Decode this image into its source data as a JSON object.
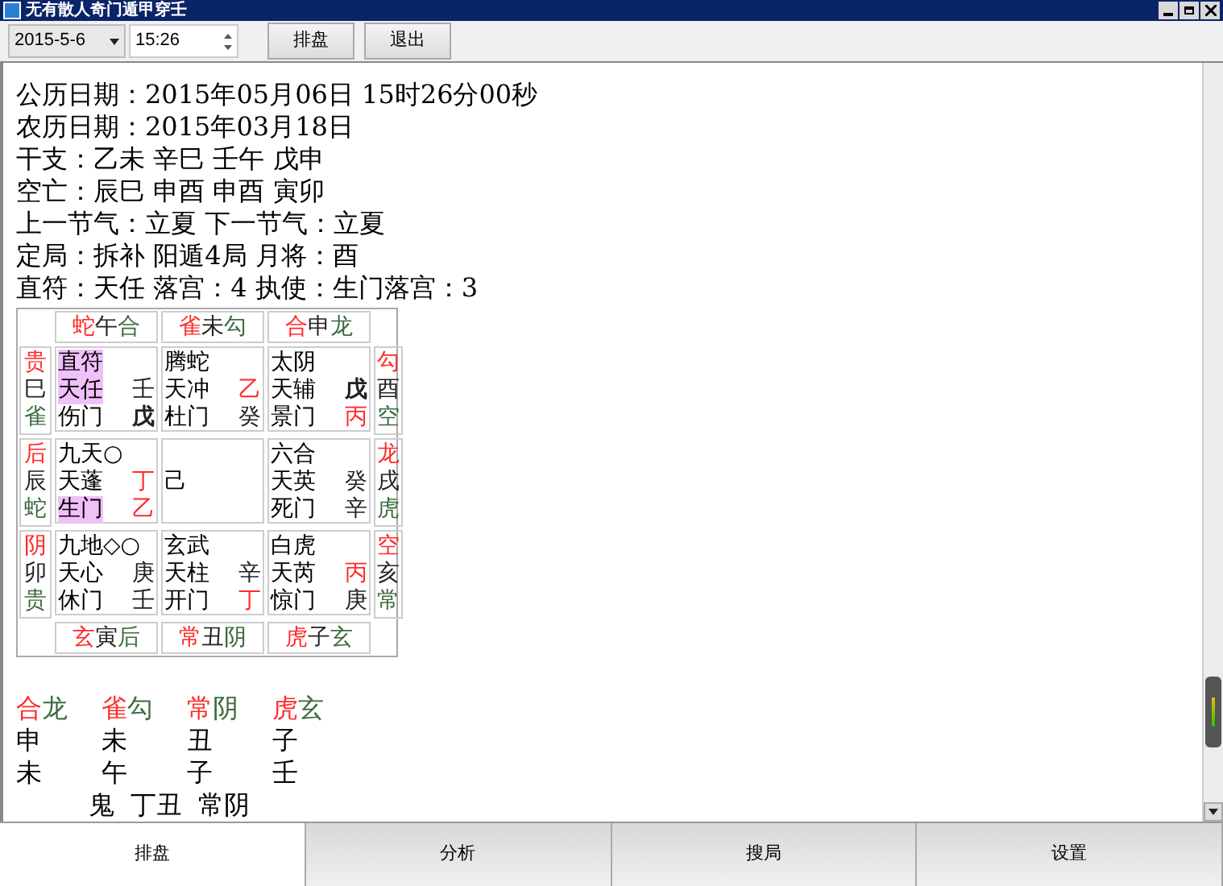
{
  "window": {
    "title": "无有散人奇门遁甲穿壬"
  },
  "toolbar": {
    "date": "2015-5-6",
    "time": "15:26",
    "buttons": [
      "排盘",
      "退出"
    ]
  },
  "info_lines": [
    "公历日期：2015年05月06日 15时26分00秒",
    "农历日期：2015年03月18日",
    "干支：乙未 辛巳 壬午 戊申",
    "空亡：辰巳 申酉 申酉 寅卯",
    "上一节气：立夏 下一节气：立夏",
    "定局：拆补 阳遁4局 月将：酉",
    "直符：天任 落宫：4 执使：生门落宫：3"
  ],
  "chart": {
    "top": [
      {
        "mark": "蛇",
        "branch": "午",
        "god": "合"
      },
      {
        "mark": "雀",
        "branch": "未",
        "god": "勾"
      },
      {
        "mark": "合",
        "branch": "申",
        "god": "龙"
      }
    ],
    "left": [
      {
        "mark": "贵",
        "branch": "巳",
        "god": "雀"
      },
      {
        "mark": "后",
        "branch": "辰",
        "god": "蛇"
      },
      {
        "mark": "阴",
        "branch": "卯",
        "god": "贵"
      }
    ],
    "right": [
      {
        "mark": "勾",
        "branch": "酉",
        "god": "空"
      },
      {
        "mark": "龙",
        "branch": "戌",
        "god": "虎"
      },
      {
        "mark": "空",
        "branch": "亥",
        "god": "常"
      }
    ],
    "bottom": [
      {
        "mark": "玄",
        "branch": "寅",
        "god": "后"
      },
      {
        "mark": "常",
        "branch": "丑",
        "god": "阴"
      },
      {
        "mark": "虎",
        "branch": "子",
        "god": "玄"
      }
    ],
    "cells": [
      [
        {
          "kind": "palace",
          "lines": [
            {
              "left": "直符",
              "highlighted": true
            },
            {
              "left": "天任",
              "highlighted": true,
              "right": "壬",
              "right_red": false,
              "right_bold": false
            },
            {
              "left": "伤门",
              "highlighted": false,
              "right": "戊",
              "right_red": false,
              "right_bold": true
            }
          ]
        },
        {
          "kind": "palace",
          "lines": [
            {
              "left": "腾蛇",
              "highlighted": false
            },
            {
              "left": "天冲",
              "highlighted": false,
              "right": "乙",
              "right_red": true,
              "right_bold": false
            },
            {
              "left": "杜门",
              "highlighted": false,
              "right": "癸",
              "right_red": false,
              "right_bold": false
            }
          ]
        },
        {
          "kind": "palace",
          "lines": [
            {
              "left": "太阴",
              "highlighted": false
            },
            {
              "left": "天辅",
              "highlighted": false,
              "right": "戊",
              "right_red": false,
              "right_bold": true
            },
            {
              "left": "景门",
              "highlighted": false,
              "right": "丙",
              "right_red": true,
              "right_bold": false
            }
          ]
        }
      ],
      [
        {
          "kind": "palace",
          "lines": [
            {
              "left": "九天○",
              "highlighted": false
            },
            {
              "left": "天蓬",
              "highlighted": false,
              "right": "丁",
              "right_red": true,
              "right_bold": false
            },
            {
              "left": "生门",
              "highlighted": true,
              "right": "乙",
              "right_red": true,
              "right_bold": false
            }
          ]
        },
        {
          "kind": "center",
          "text": "己"
        },
        {
          "kind": "palace",
          "lines": [
            {
              "left": "六合",
              "highlighted": false
            },
            {
              "left": "天英",
              "highlighted": false,
              "right": "癸",
              "right_red": false,
              "right_bold": false
            },
            {
              "left": "死门",
              "highlighted": false,
              "right": "辛",
              "right_red": false,
              "right_bold": false
            }
          ]
        }
      ],
      [
        {
          "kind": "palace",
          "lines": [
            {
              "left": "九地◇○",
              "highlighted": false
            },
            {
              "left": "天心",
              "highlighted": false,
              "right": "庚",
              "right_red": false,
              "right_bold": false
            },
            {
              "left": "休门",
              "highlighted": false,
              "right": "壬",
              "right_red": false,
              "right_bold": false
            }
          ]
        },
        {
          "kind": "palace",
          "lines": [
            {
              "left": "玄武",
              "highlighted": false
            },
            {
              "left": "天柱",
              "highlighted": false,
              "right": "辛",
              "right_red": false,
              "right_bold": false
            },
            {
              "left": "开门",
              "highlighted": false,
              "right": "丁",
              "right_red": true,
              "right_bold": false
            }
          ]
        },
        {
          "kind": "palace",
          "lines": [
            {
              "left": "白虎",
              "highlighted": false
            },
            {
              "left": "天芮",
              "highlighted": false,
              "right": "丙",
              "right_red": true,
              "right_bold": false
            },
            {
              "left": "惊门",
              "highlighted": false,
              "right": "庚",
              "right_red": false,
              "right_bold": false
            }
          ]
        }
      ]
    ]
  },
  "summary": {
    "columns": [
      {
        "mark": "合",
        "god": "龙",
        "lines": [
          "申",
          "未"
        ]
      },
      {
        "mark": "雀",
        "god": "勾",
        "lines": [
          "未",
          "午"
        ]
      },
      {
        "mark": "常",
        "god": "阴",
        "lines": [
          "丑",
          "子"
        ]
      },
      {
        "mark": "虎",
        "god": "玄",
        "lines": [
          "子",
          "壬"
        ]
      }
    ],
    "extra": [
      "鬼",
      "丁丑",
      "常阴"
    ]
  },
  "tabs": [
    {
      "label": "排盘",
      "selected": true
    },
    {
      "label": "分析",
      "selected": false
    },
    {
      "label": "搜局",
      "selected": false
    },
    {
      "label": "设置",
      "selected": false
    }
  ]
}
